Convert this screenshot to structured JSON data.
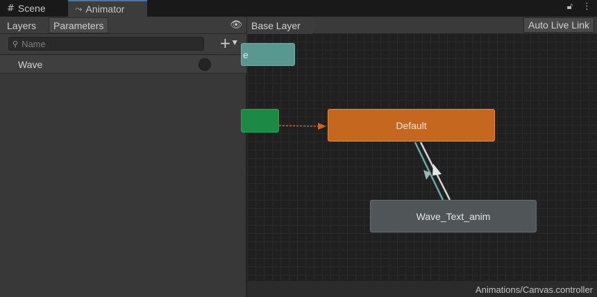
{
  "tabs": [
    {
      "label": "Scene",
      "icon": "grid-icon"
    },
    {
      "label": "Animator",
      "icon": "animator-icon"
    }
  ],
  "window": {
    "lock_icon": "lock-icon",
    "menu_icon": "more-icon"
  },
  "left_panel": {
    "subtabs": [
      "Layers",
      "Parameters"
    ],
    "visibility_icon": "eye-icon",
    "search": {
      "placeholder": "Name",
      "value": ""
    },
    "add_icon": "plus-icon",
    "parameters": [
      {
        "name": "Wave",
        "type_icon": "trigger-icon"
      }
    ]
  },
  "graph": {
    "breadcrumb": "Base Layer",
    "auto_live_link": "Auto Live Link",
    "nodes": {
      "any_state": "e",
      "entry": "",
      "default": "Default",
      "wave": "Wave_Text_anim"
    },
    "colors": {
      "default_state": "#c6671f",
      "entry": "#1c8a44",
      "any_state": "#5a9790",
      "state": "#505558",
      "transition_orange": "#c6671f",
      "transition_light": "#cfd6d6",
      "transition_teal": "#6aa9a8"
    }
  },
  "status": {
    "controller_path": "Animations/Canvas.controller"
  }
}
